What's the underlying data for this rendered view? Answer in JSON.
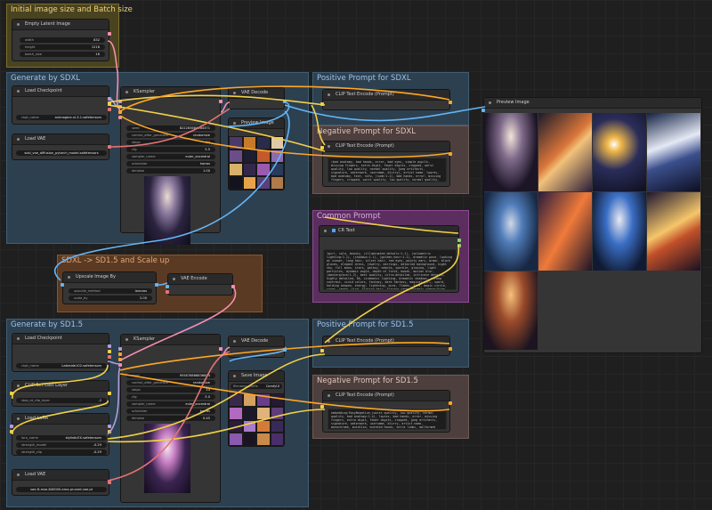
{
  "groups": {
    "initial": "Initial image size and Batch size",
    "sdxl": "Generate by SDXL",
    "pos_sdxl": "Positive Prompt for SDXL",
    "neg_sdxl": "Negative Prompt for SDXL",
    "common": "Common Prompt",
    "upscale": "SDXL -> SD1.5 and Scale up",
    "sd15": "Generate by SD1.5",
    "pos_sd15": "Positive Prompt for SD1.5",
    "neg_sd15": "Negative Prompt for SD1.5"
  },
  "empty_latent": {
    "title": "Empty Latent Image",
    "width_label": "width",
    "width": "832",
    "height_label": "height",
    "height": "1216",
    "batch_label": "batch_size",
    "batch": "16"
  },
  "sdxl_ckpt": {
    "title": "Load Checkpoint",
    "label": "ckpt_name",
    "value": "animagine-xl-3.1.safetensors"
  },
  "sdxl_vae": {
    "title": "Load VAE",
    "value": "sdxl_vae_diffusion_pytorch_model.safetensors"
  },
  "sdxl_ksampler": {
    "title": "KSampler",
    "rows": [
      {
        "label": "seed",
        "value": "822283684484371"
      },
      {
        "label": "control_after_generate",
        "value": "randomize"
      },
      {
        "label": "steps",
        "value": "24"
      },
      {
        "label": "cfg",
        "value": "5.5"
      },
      {
        "label": "sampler_name",
        "value": "euler_ancestral"
      },
      {
        "label": "scheduler",
        "value": "karras"
      },
      {
        "label": "denoise",
        "value": "1.00"
      }
    ]
  },
  "sdxl_vae_decode": {
    "title": "VAE Decode"
  },
  "sdxl_preview": {
    "title": "Preview Image"
  },
  "pos_sdxl_node": {
    "title": "CLIP Text Encode (Prompt)"
  },
  "neg_sdxl_node": {
    "title": "CLIP Text Encode (Prompt)",
    "text": "(bad anatomy, bad hands, error, bad eyes, simple pupils, missing fingers, extra digit, fewer digits, cropped, worst quality, low quality, normal quality, jpeg artifacts, signature, watermark, username, blurry), artist name, lowres, bad anatomy, text, nsfw, (nude:1.2), bad hands, error, missing fingers, cropped, worst quality, low quality, normal quality, jpeg artifacts, signature, watermark, username, blurry, artist name, missing arm, missing leg, ugly face, out of frame, deformed, distorted, poorly drawn, bad proportions, gross proportions, cloned face, disfigured, mutation, mutated hands, extra limbs, malformed limbs, extra arms, extra legs, fused fingers, too many fingers, long neck, username, signature, multiple views, portrait, flat shading, blush, ugly"
  },
  "common_node": {
    "title": "CR Text",
    "text": "1girl, solo, beauty, (illuminated details:1.1), (volumetric lighting:1.1), (shadows:1.1), (golden hour:1.1), dramatic pose, looking at viewer, long hair, silver hair, red eyes, pointy ears, armor, black gloves, elegant dress, jewelry, earrings, detailed background, night sky, full moon, stars, galaxy, nebula, sparkle, glowing, light particles, dynamic angle, depth of field, bokeh, motion blur, (masterpiece:1.2), best quality, ultra-detailed, intricate details, highly detailed, 8k, cinematic lighting, dramatic shadows, strong contrast, vivid colors, fantasy, dark fantasy, magical girl, sword, holding weapon, energy, lightning, aura, flames, fire, magic circle, runes, smoke, wind, flowing hair, flowing cape, dynamic composition, action pose, battle stance, epic scene, dramatic, intense, powerful, detailed face, detailed eyes, beautiful detailed eyes, detailed hair, perfect face, perfect anatomy, absurdres, high resolution, anime style, soft focus, depth of field, double exposure"
  },
  "upscale_node": {
    "title": "Upscale Image By",
    "method_label": "upscale_method",
    "method": "lanczos",
    "scale_label": "scale_by",
    "scale": "2.00"
  },
  "upscale_vae_encode": {
    "title": "VAE Encode"
  },
  "sd15_ckpt": {
    "title": "Load Checkpoint",
    "label": "ckpt_name",
    "value": "Lakeside102.safetensors"
  },
  "sd15_clipskip": {
    "title": "CLIP Set Last Layer",
    "label": "stop_at_clip_layer",
    "value": "-2"
  },
  "sd15_lora": {
    "title": "Load LoRA",
    "name_label": "lora_name",
    "name": "stylisticEX.safetensors",
    "model_label": "strength_model",
    "model": "-0.29",
    "clip_label": "strength_clip",
    "clip": "-0.29"
  },
  "sd15_vae": {
    "title": "Load VAE",
    "value": "vae-ft-mse-840000-ema-pruned.vae.pt"
  },
  "sd15_ksampler": {
    "title": "KSampler",
    "rows": [
      {
        "label": "seed",
        "value": "955876866836894"
      },
      {
        "label": "control_after_generate",
        "value": "randomize"
      },
      {
        "label": "steps",
        "value": "14"
      },
      {
        "label": "cfg",
        "value": "5.0"
      },
      {
        "label": "sampler_name",
        "value": "euler_ancestral"
      },
      {
        "label": "scheduler",
        "value": "karras"
      },
      {
        "label": "denoise",
        "value": "0.45"
      }
    ]
  },
  "sd15_vae_decode": {
    "title": "VAE Decode"
  },
  "sd15_save": {
    "title": "Save Image",
    "prefix_label": "filename_prefix",
    "prefix": "ComfyUI"
  },
  "pos_sd15_node": {
    "title": "CLIP Text Encode (Prompt)"
  },
  "neg_sd15_node": {
    "title": "CLIP Text Encode (Prompt)",
    "text": "embedding:EasyNegative,(worst quality, low quality, normal quality, bad anatomy:1.4), lowres, bad hands, error, missing fingers, extra digit, fewer digits, cropped, jpeg artifacts, signature, watermark, username, blurry, artist name, monochrome, mutation, mutated hands, extra limbs, malformed limbs, cloned face, disfigured, bad proportions, poorly drawn hands, poorly drawn face, gross proportions, extra arms, extra legs, fused fingers, too many fingers, long neck, nsfw, blush, ugly"
  },
  "right_preview": {
    "title": "Preview Image"
  },
  "colors": {
    "model": "#b39ddb",
    "clip": "#f1d04a",
    "vae": "#e57373",
    "latent": "#f48fb1",
    "image": "#64b5f6",
    "cond": "#ffa726"
  }
}
